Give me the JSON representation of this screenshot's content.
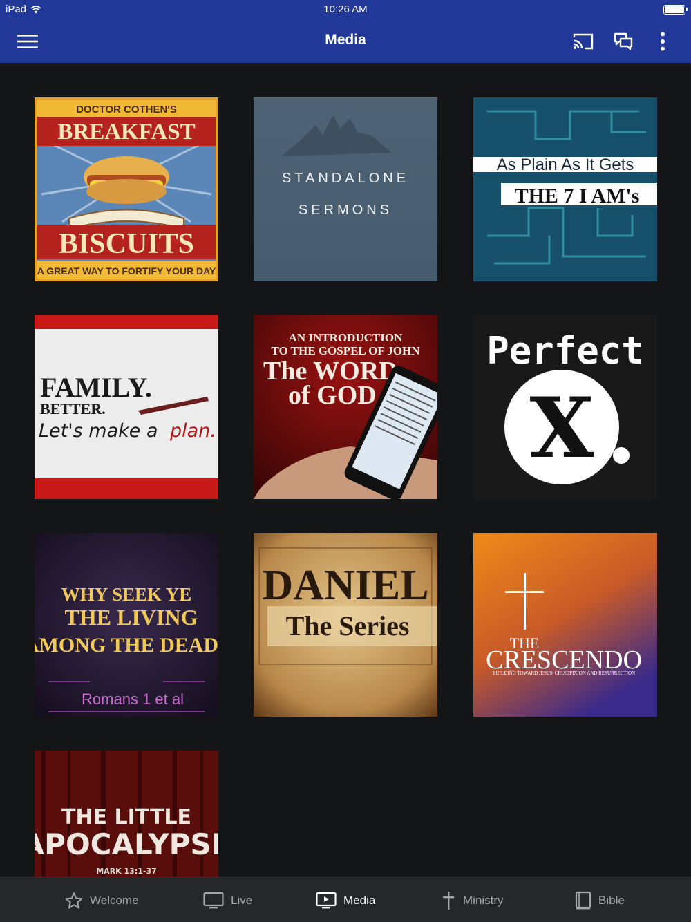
{
  "status": {
    "carrier": "iPad",
    "time": "10:26 AM"
  },
  "header": {
    "title": "Media"
  },
  "tiles": [
    {
      "label": "Doctor Cothen's Breakfast Biscuits",
      "line1": "DOCTOR COTHEN'S",
      "line2": "BREAKFAST",
      "line3": "BISCUITS",
      "line4": "A GREAT WAY TO FORTIFY YOUR DAY"
    },
    {
      "label": "Standalone Sermons",
      "line1": "STANDALONE",
      "line2": "SERMONS"
    },
    {
      "label": "As Plain As It Gets - The 7 I AM's",
      "line1": "As Plain As It Gets",
      "line2": "THE 7 I AM's"
    },
    {
      "label": "Family. Better. Let's make a plan.",
      "line1": "FAMILY.",
      "line2": "BETTER.",
      "line3": "Let's make a",
      "line4": "plan."
    },
    {
      "label": "An Introduction to the Gospel of John - The Word of God",
      "line1": "AN INTRODUCTION",
      "line2": "TO THE GOSPEL OF JOHN",
      "line3": "The WORD",
      "line4": "of GOD"
    },
    {
      "label": "Perfect X.",
      "line1": "Perfect",
      "line2": "X"
    },
    {
      "label": "Why Seek Ye The Living Among The Dead?",
      "line1": "WHY SEEK YE",
      "line2": "THE LIVING",
      "line3": "AMONG THE DEAD?",
      "line4": "Romans 1 et al"
    },
    {
      "label": "Daniel The Series",
      "line1": "DANIEL",
      "line2": "The Series"
    },
    {
      "label": "The Crescendo",
      "line1": "THE",
      "line2": "CRESCENDO",
      "line3": "BUILDING TOWARD JESUS' CRUCIFIXION AND RESURRECTION"
    },
    {
      "label": "The Little Apocalypse",
      "line1": "THE LITTLE",
      "line2": "APOCALYPSE",
      "line3": "MARK 13:1-37"
    }
  ],
  "tabs": [
    {
      "label": "Welcome",
      "icon": "star-icon"
    },
    {
      "label": "Live",
      "icon": "monitor-icon"
    },
    {
      "label": "Media",
      "icon": "play-screen-icon",
      "active": true
    },
    {
      "label": "Ministry",
      "icon": "cross-icon"
    },
    {
      "label": "Bible",
      "icon": "book-icon"
    }
  ]
}
